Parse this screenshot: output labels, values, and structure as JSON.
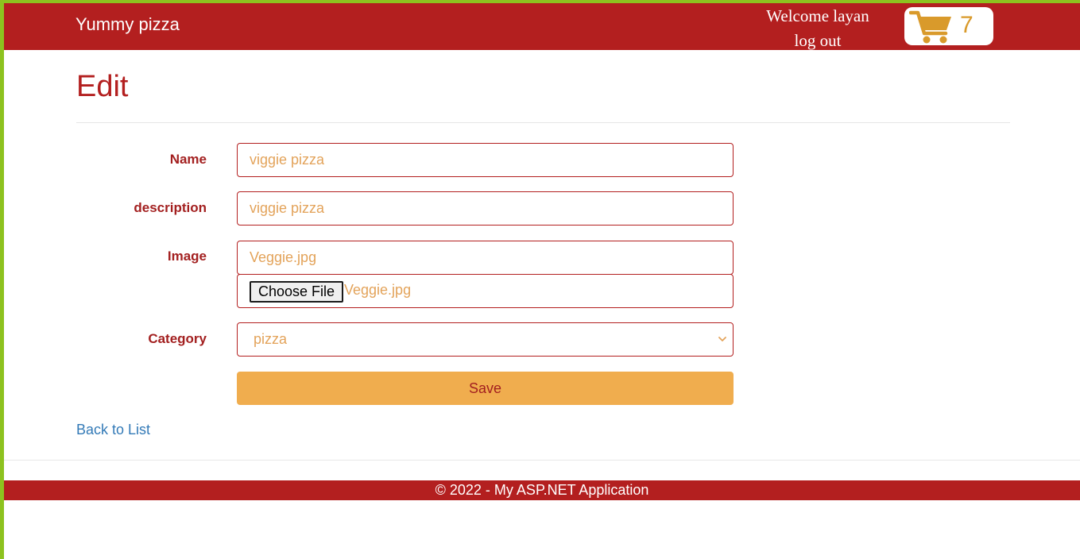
{
  "navbar": {
    "brand": "Yummy pizza",
    "welcome": "Welcome layan",
    "logout": "log out",
    "cart_count": "7",
    "cart_icon": "shopping-cart-icon"
  },
  "page": {
    "title": "Edit"
  },
  "form": {
    "name_label": "Name",
    "name_value": "viggie pizza",
    "description_label": "description",
    "description_value": "viggie pizza",
    "image_label": "Image",
    "image_value": "Veggie.jpg",
    "file_button_label": "Choose File",
    "file_name": "Veggie.jpg",
    "category_label": "Category",
    "category_value": "pizza",
    "save_label": "Save"
  },
  "links": {
    "back_to_list": "Back to List"
  },
  "footer": {
    "text": "© 2022 - My ASP.NET Application"
  },
  "colors": {
    "brand_red": "#b31f1f",
    "accent_orange": "#f0ad4e",
    "value_text": "#e3a35a",
    "page_border_green": "#8dc21f",
    "link_blue": "#337ab7"
  }
}
